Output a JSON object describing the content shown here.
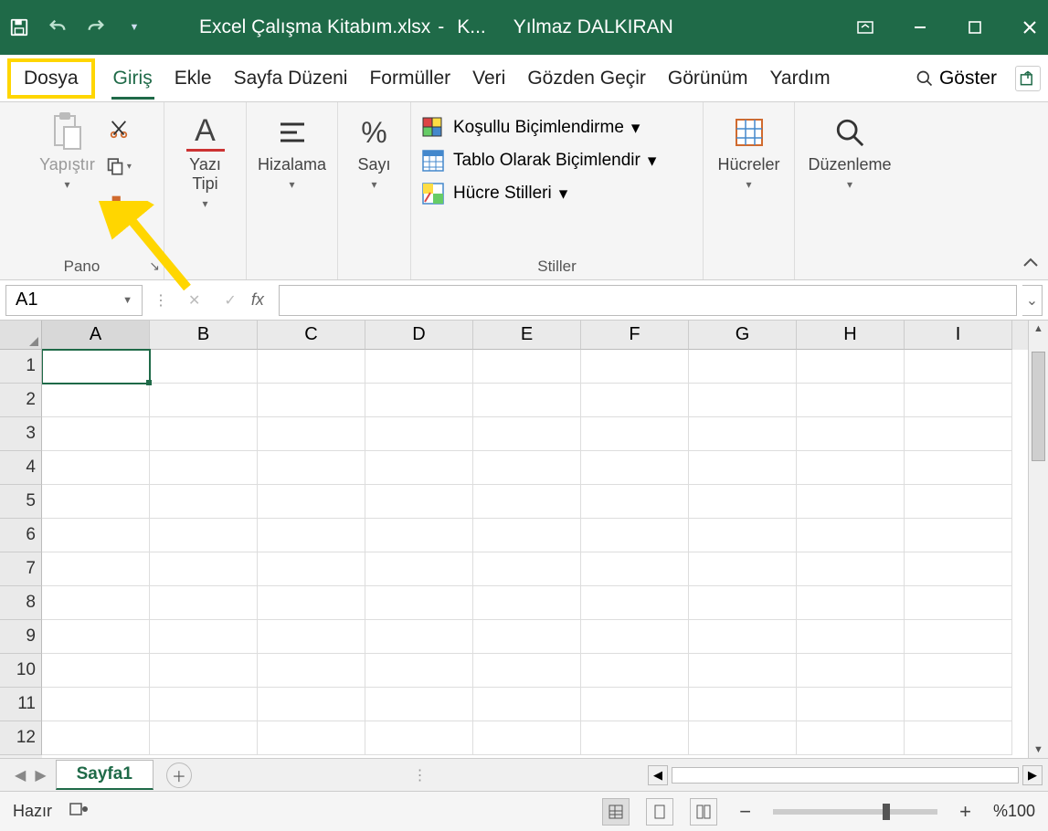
{
  "title": {
    "doc": "Excel Çalışma Kitabım.xlsx",
    "sep": "-",
    "app": "K...",
    "user": "Yılmaz DALKIRAN"
  },
  "tabs": {
    "file": "Dosya",
    "home": "Giriş",
    "insert": "Ekle",
    "layout": "Sayfa Düzeni",
    "formulas": "Formüller",
    "data": "Veri",
    "review": "Gözden Geçir",
    "view": "Görünüm",
    "help": "Yardım",
    "search": "Göster"
  },
  "ribbon": {
    "pano": {
      "label": "Pano",
      "paste": "Yapıştır"
    },
    "font": {
      "label": "Yazı Tipi"
    },
    "align": {
      "label": "Hizalama"
    },
    "number": {
      "label": "Sayı"
    },
    "styles": {
      "label": "Stiller",
      "cond": "Koşullu Biçimlendirme",
      "table": "Tablo Olarak Biçimlendir",
      "cell": "Hücre Stilleri"
    },
    "cells": {
      "label": "Hücreler"
    },
    "edit": {
      "label": "Düzenleme"
    }
  },
  "formula": {
    "cellref": "A1",
    "fx": "fx",
    "value": ""
  },
  "grid": {
    "cols": [
      "A",
      "B",
      "C",
      "D",
      "E",
      "F",
      "G",
      "H",
      "I"
    ],
    "rows": [
      "1",
      "2",
      "3",
      "4",
      "5",
      "6",
      "7",
      "8",
      "9",
      "10",
      "11",
      "12"
    ],
    "selected": "A1"
  },
  "sheet": {
    "name": "Sayfa1"
  },
  "status": {
    "ready": "Hazır",
    "zoom": "%100"
  }
}
